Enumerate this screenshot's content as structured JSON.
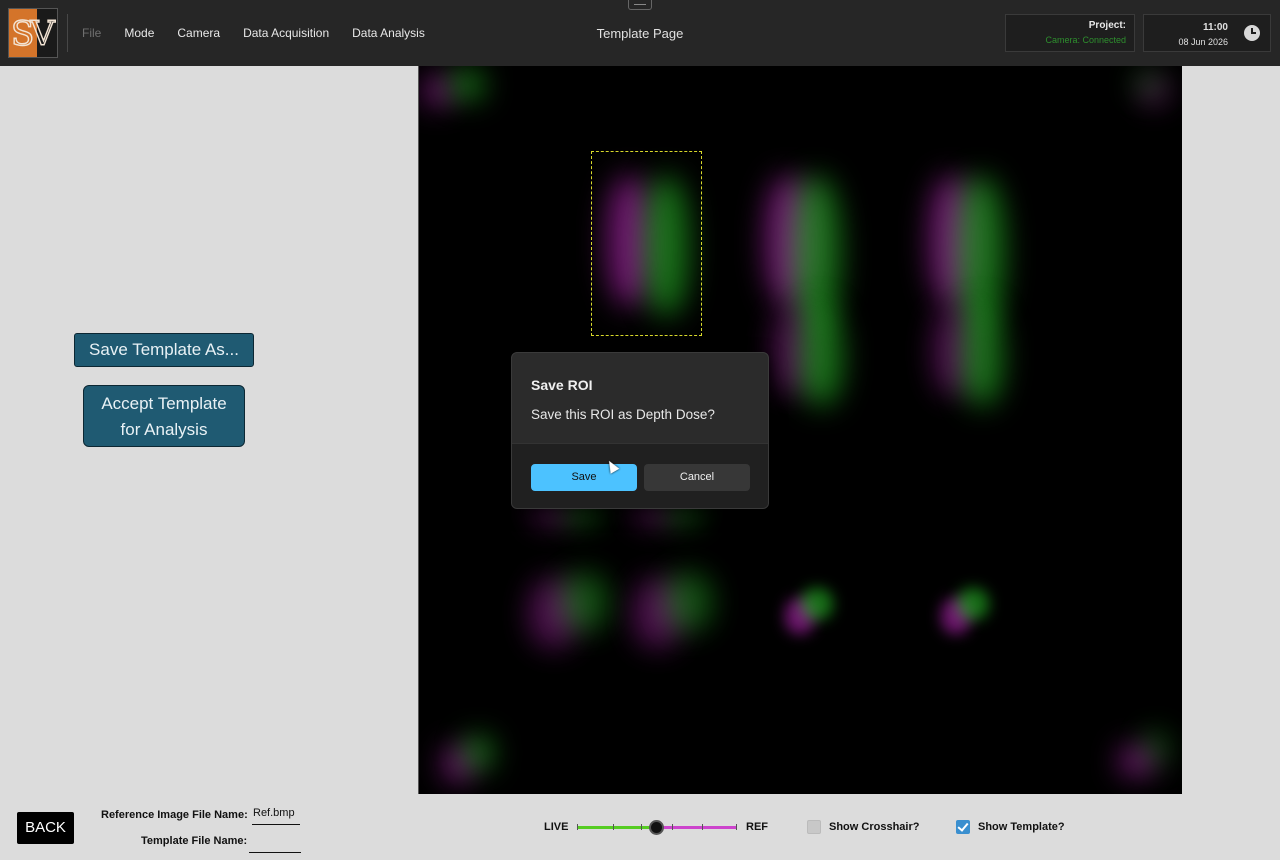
{
  "header": {
    "logo_text": "SV",
    "menu": [
      "File",
      "Mode",
      "Camera",
      "Data Acquisition",
      "Data Analysis"
    ],
    "page_title": "Template Page",
    "project_label": "Project:",
    "camera_status": "Camera: Connected",
    "time": "11:00",
    "date": "08 Jun 2026"
  },
  "left_panel": {
    "save_template_label": "Save Template As...",
    "accept_template_line1": "Accept Template",
    "accept_template_line2": "for Analysis"
  },
  "dialog": {
    "title": "Save ROI",
    "message": "Save this ROI as Depth Dose?",
    "save_label": "Save",
    "cancel_label": "Cancel"
  },
  "footer": {
    "back_label": "BACK",
    "reference_label": "Reference Image File Name:",
    "reference_value": "Ref.bmp",
    "template_label": "Template File Name:",
    "template_value": "",
    "live_label": "LIVE",
    "ref_label": "REF",
    "blend_fraction": 0.5,
    "show_crosshair_label": "Show Crosshair?",
    "show_crosshair_checked": false,
    "show_template_label": "Show Template?",
    "show_template_checked": true
  },
  "colors": {
    "accent_button": "#1f5a72",
    "dialog_primary": "#4cc2ff",
    "status_connected": "#2e8f2e",
    "roi_outline": "#d8d82a"
  }
}
